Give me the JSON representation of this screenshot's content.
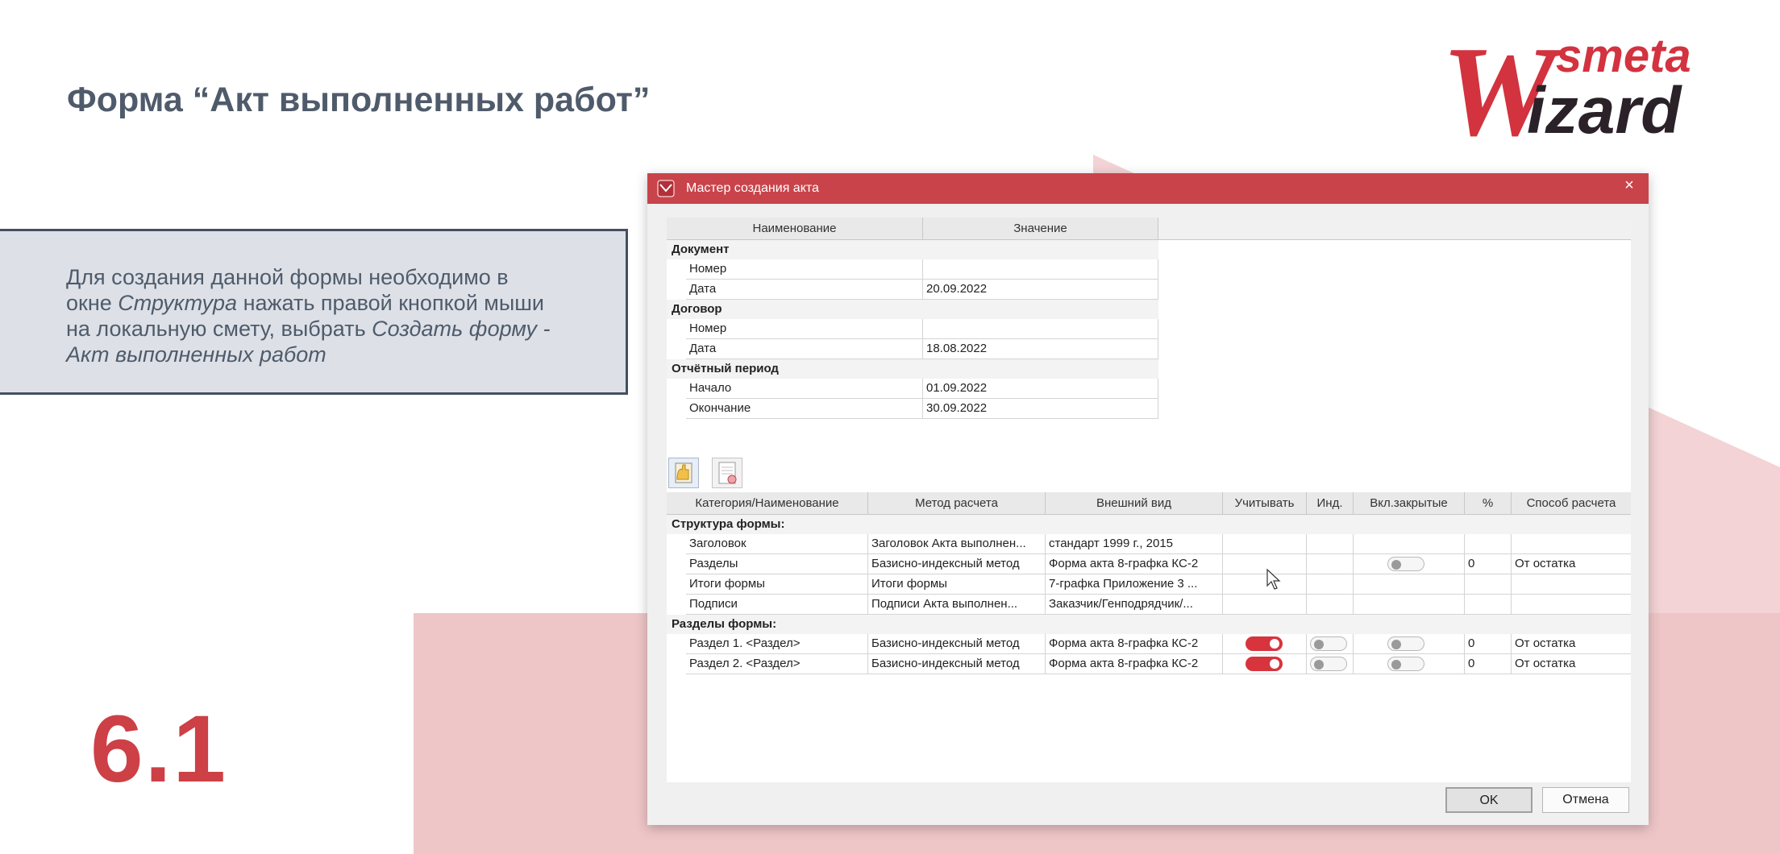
{
  "page_title": "Форма “Акт выполненных работ”",
  "info": {
    "line1": "Для создания данной формы необходимо в",
    "line2_a": "окне ",
    "line2_b": "Структура",
    "line2_c": " нажать правой кнопкой мыши",
    "line3_a": "на локальную смету, выбрать ",
    "line3_b": "Создать форму -",
    "line4": "Акт выполненных работ"
  },
  "slide_number": "6.1",
  "logo": {
    "top": "smeta",
    "initial": "W",
    "rest": "izard"
  },
  "colors": {
    "accent": "#c9444a",
    "title_text": "#4f5b6b",
    "number": "#cc4046"
  },
  "dialog": {
    "title": "Мастер создания акта",
    "close_icon": "×",
    "properties": {
      "headers": [
        "Наименование",
        "Значение"
      ],
      "groups": [
        {
          "name": "Документ",
          "rows": [
            [
              "Номер",
              ""
            ],
            [
              "Дата",
              "20.09.2022"
            ]
          ]
        },
        {
          "name": "Договор",
          "rows": [
            [
              "Номер",
              ""
            ],
            [
              "Дата",
              "18.08.2022"
            ]
          ]
        },
        {
          "name": "Отчётный период",
          "rows": [
            [
              "Начало",
              "01.09.2022"
            ],
            [
              "Окончание",
              "30.09.2022"
            ]
          ]
        }
      ]
    },
    "toolbar": [
      "add-section-icon",
      "delete-section-icon"
    ],
    "structure": {
      "headers": [
        "Категория/Наименование",
        "Метод расчета",
        "Внешний вид",
        "Учитывать",
        "Инд.",
        "Вкл.закрытые",
        "%",
        "Способ расчета"
      ],
      "groups": [
        {
          "name": "Структура формы:",
          "rows": [
            {
              "name": "Заголовок",
              "method": "Заголовок Акта выполнен...",
              "view": "стандарт 1999 г., 2015",
              "include": null,
              "ind": null,
              "closed": null,
              "percent": "",
              "calc": ""
            },
            {
              "name": "Разделы",
              "method": "Базисно-индексный метод",
              "view": "Форма акта 8-графка КС-2",
              "include": null,
              "ind": null,
              "closed": false,
              "percent": "0",
              "calc": "От остатка"
            },
            {
              "name": "Итоги формы",
              "method": "Итоги формы",
              "view": "7-графка Приложение 3 ...",
              "include": null,
              "ind": null,
              "closed": null,
              "percent": "",
              "calc": ""
            },
            {
              "name": "Подписи",
              "method": "Подписи Акта выполнен...",
              "view": "Заказчик/Генподрядчик/...",
              "include": null,
              "ind": null,
              "closed": null,
              "percent": "",
              "calc": ""
            }
          ]
        },
        {
          "name": "Разделы формы:",
          "rows": [
            {
              "name": "Раздел 1. <Раздел>",
              "method": "Базисно-индексный метод",
              "view": "Форма акта 8-графка КС-2",
              "include": true,
              "ind": false,
              "closed": false,
              "percent": "0",
              "calc": "От остатка"
            },
            {
              "name": "Раздел 2. <Раздел>",
              "method": "Базисно-индексный метод",
              "view": "Форма акта 8-графка КС-2",
              "include": true,
              "ind": false,
              "closed": false,
              "percent": "0",
              "calc": "От остатка"
            }
          ]
        }
      ]
    },
    "buttons": {
      "ok": "OK",
      "cancel": "Отмена"
    }
  }
}
